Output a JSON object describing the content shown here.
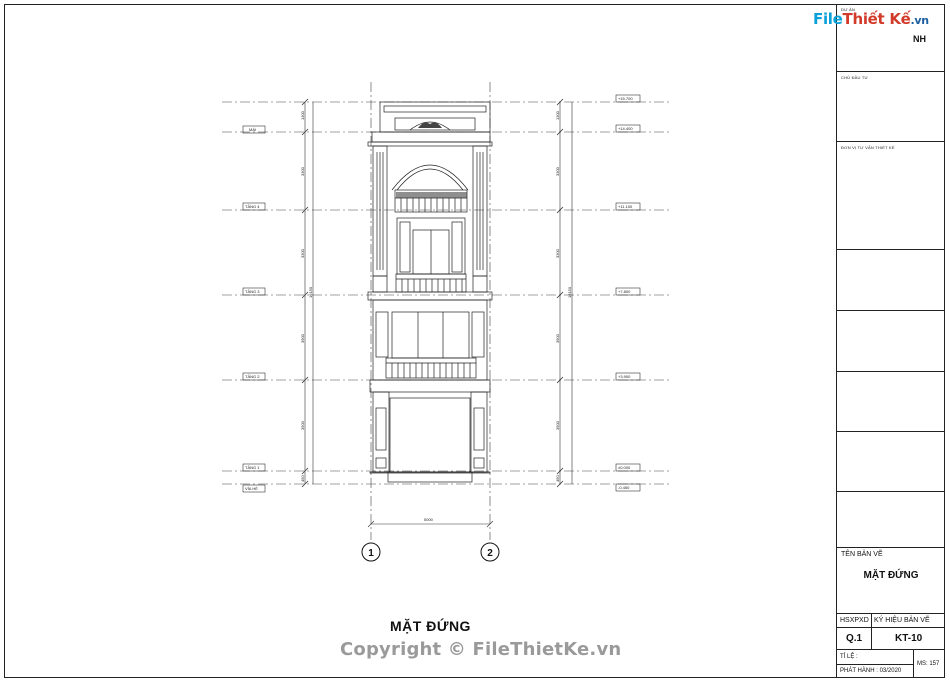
{
  "logo": {
    "part1": "File",
    "part2": "Thiết Kế",
    "part3": ".vn"
  },
  "title_block": {
    "project_label": "DỰ ÁN",
    "project_suffix": "NH",
    "owner_label": "CHỦ ĐẦU TƯ",
    "consultant_label": "ĐƠN VỊ TƯ VẤN THIẾT KẾ",
    "sheet_title_label": "TÊN BẢN VẼ",
    "sheet_title": "MẶT ĐỨNG",
    "hsxpxd_label": "HSXPXD",
    "symbol_label": "KÝ HIỆU BẢN VẼ",
    "hsxpxd_value": "Q.1",
    "symbol_value": "KT-10",
    "scale_label": "TỈ LỆ :",
    "issue_label": "PHÁT HÀNH : 03/2020",
    "ms_label": "MS: 157"
  },
  "drawing": {
    "title": "MẶT ĐỨNG",
    "levels": [
      {
        "name": "",
        "elevation": "+15.700"
      },
      {
        "name": "MÁI",
        "elevation": "+14.400"
      },
      {
        "name": "TẦNG 4",
        "elevation": "+11.100"
      },
      {
        "name": "TẦNG 3",
        "elevation": "+7.800"
      },
      {
        "name": "TẦNG 2",
        "elevation": "+3.900"
      },
      {
        "name": "TẦNG 1",
        "elevation": "±0.000"
      },
      {
        "name": "VỈA HÈ",
        "elevation": "-0.450"
      }
    ],
    "left_dims": [
      "1300",
      "3300",
      "3300",
      "3900",
      "3900",
      "450"
    ],
    "left_total": "16150",
    "right_dims": [
      "1300",
      "3300",
      "3300",
      "3900",
      "3900",
      "450"
    ],
    "right_total": "16150",
    "width_dim": "5000",
    "grid_axes": [
      "1",
      "2"
    ]
  },
  "copyright": "Copyright © FileThietKe.vn"
}
